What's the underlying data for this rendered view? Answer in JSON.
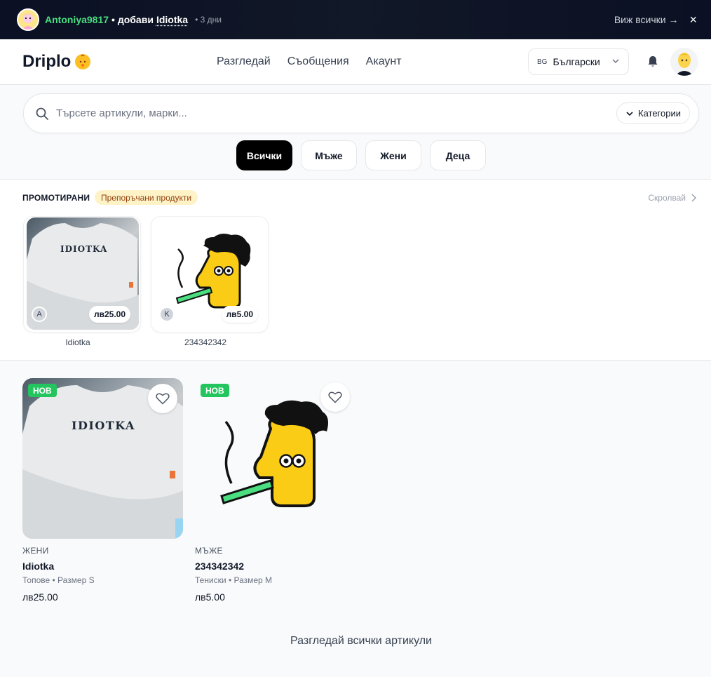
{
  "activity": {
    "user": "Antoniya9817",
    "action": "• добави",
    "item": "Idiotka",
    "time": "• 3 дни",
    "view_all": "Виж всички →",
    "close_label": "×"
  },
  "header": {
    "logo": "Driplo",
    "nav": [
      "Разгледай",
      "Съобщения",
      "Акаунт"
    ],
    "lang_code": "BG",
    "lang_label": "Български"
  },
  "search": {
    "placeholder": "Търсете артикули, марки...",
    "categories_label": "Категории"
  },
  "filters": [
    {
      "label": "Всички",
      "active": true
    },
    {
      "label": "Мъже",
      "active": false
    },
    {
      "label": "Жени",
      "active": false
    },
    {
      "label": "Деца",
      "active": false
    }
  ],
  "promoted": {
    "title": "ПРОМОТИРАНИ",
    "badge": "Препоръчани продукти",
    "scroll_label": "Скролвай",
    "items": [
      {
        "name": "Idiotka",
        "price": "лв25.00",
        "seller_initial": "A",
        "image_text": "IDIOTKA"
      },
      {
        "name": "234342342",
        "price": "лв5.00",
        "seller_initial": "K"
      }
    ]
  },
  "listings": [
    {
      "badge": "НОВ",
      "category": "ЖЕНИ",
      "title": "Idiotka",
      "meta": "Топове • Размер S",
      "price": "лв25.00",
      "image_text": "IDIOTKA"
    },
    {
      "badge": "НОВ",
      "category": "МЪЖЕ",
      "title": "234342342",
      "meta": "Тениски • Размер M",
      "price": "лв5.00"
    }
  ],
  "browse_all": "Разгледай всички артикули",
  "colors": {
    "accent_green": "#22c55e",
    "username_green": "#4ade80",
    "badge_yellow": "#fef3c7",
    "topbar_dark": "#0b1024"
  }
}
